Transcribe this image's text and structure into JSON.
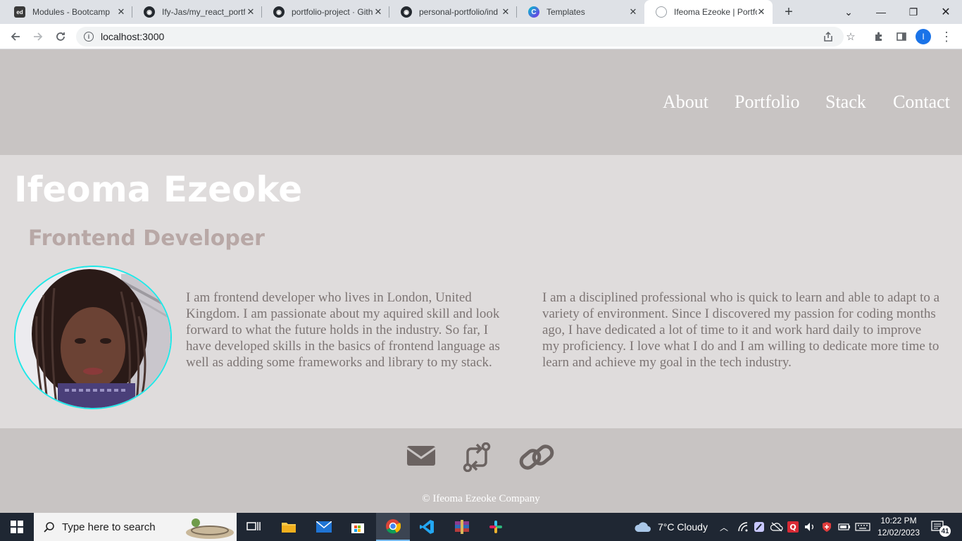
{
  "browser": {
    "tabs": [
      {
        "title": "Modules - Bootcamp",
        "icon": "bootcamp-icon"
      },
      {
        "title": "Ify-Jas/my_react_portf",
        "icon": "github-icon"
      },
      {
        "title": "portfolio-project · Gith",
        "icon": "github-icon"
      },
      {
        "title": "personal-portfolio/ind",
        "icon": "github-icon"
      },
      {
        "title": "Templates",
        "icon": "canva-icon"
      },
      {
        "title": "Ifeoma Ezeoke | Portfo",
        "icon": "globe-icon"
      }
    ],
    "url": "localhost:3000",
    "profile_initial": "I"
  },
  "site": {
    "nav": [
      "About",
      "Portfolio",
      "Stack",
      "Contact"
    ],
    "name": "Ifeoma Ezeoke",
    "role": "Frontend Developer",
    "bio_left": "I am frontend developer who lives in London, United Kingdom. I am passionate about my aquired skill and look forward to what the future holds in the industry. So far, I have developed skills in the basics of frontend language as well as adding some frameworks and library to my stack.",
    "bio_right": "I am a disciplined professional who is quick to learn and able to adapt to a variety of environment. Since I discovered my passion for coding months ago, I have dedicated a lot of time to it and work hard daily to improve my proficiency. I love what I do and I am willing to dedicate more time to learn and achieve my goal in the tech industry.",
    "footer_icons": [
      "envelope-icon",
      "git-compare-icon",
      "link-icon"
    ],
    "copyright": "© Ifeoma Ezeoke Company",
    "colors": {
      "header_bg": "#c8c4c3",
      "body_bg": "#dfdcdc",
      "accent_ring": "#1ee8e8",
      "role_text": "#b8a8a6"
    }
  },
  "taskbar": {
    "search_placeholder": "Type here to search",
    "weather": "7°C  Cloudy",
    "time": "10:22 PM",
    "date": "12/02/2023",
    "notifications": "41"
  }
}
